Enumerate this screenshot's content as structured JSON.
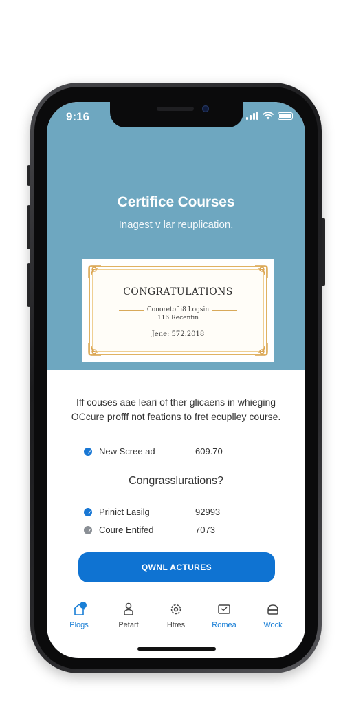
{
  "status_bar": {
    "time": "9:16"
  },
  "hero": {
    "title": "Certifice Courses",
    "subtitle": "Inagest v lar reuplication.",
    "background_color": "#6ea7c0"
  },
  "certificate": {
    "heading": "CONGRATULATIONS",
    "line1": "Conoretof i8 Logsin",
    "line2": "116 Recenfin",
    "date": "Jene: 572.2018"
  },
  "intro_text": "Iff couses aae leari of ther glicaens in whieging OCcure profff not feations to fret ecuplley course.",
  "stats_top": [
    {
      "label": "New Scree ad",
      "value": "609.70",
      "icon": "check-circle-icon",
      "color": "#1877d4"
    }
  ],
  "congrats_heading": "Congrasslurations?",
  "stats_bottom": [
    {
      "label": "Prinict Lasilg",
      "value": "92993",
      "icon": "check-circle-icon",
      "color": "#1877d4"
    },
    {
      "label": "Coure Entifed",
      "value": "7073",
      "icon": "circle-icon",
      "color": "#8a8f95"
    }
  ],
  "cta": {
    "label": "QWNL ACTURES",
    "color": "#0f73d2"
  },
  "tabs": [
    {
      "label": "Plogs",
      "icon": "home-icon",
      "active": true
    },
    {
      "label": "Petart",
      "icon": "person-icon",
      "active": false
    },
    {
      "label": "Htres",
      "icon": "gear-icon",
      "active": false
    },
    {
      "label": "Romea",
      "icon": "chat-icon",
      "active": true
    },
    {
      "label": "Wock",
      "icon": "bag-icon",
      "active": true
    }
  ],
  "accent_color": "#1a7fd6"
}
